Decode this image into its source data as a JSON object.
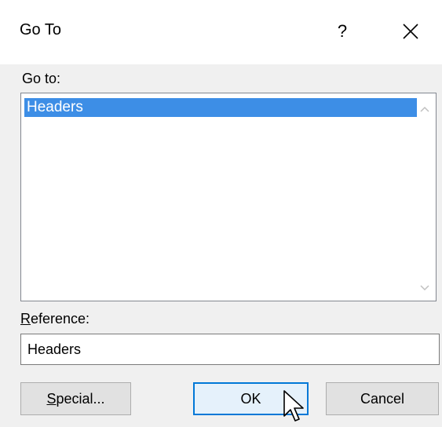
{
  "dialog": {
    "title": "Go To",
    "help_label": "?",
    "close_icon": "close-icon"
  },
  "goto": {
    "label": "Go to:",
    "items": [
      {
        "label": "Headers",
        "selected": true
      }
    ]
  },
  "reference": {
    "label_accel": "R",
    "label_rest": "eference:",
    "value": "Headers"
  },
  "buttons": {
    "special_accel": "S",
    "special_rest": "pecial...",
    "ok": "OK",
    "cancel": "Cancel"
  },
  "colors": {
    "selection": "#3d8ee6",
    "ok_border": "#0078d7"
  }
}
